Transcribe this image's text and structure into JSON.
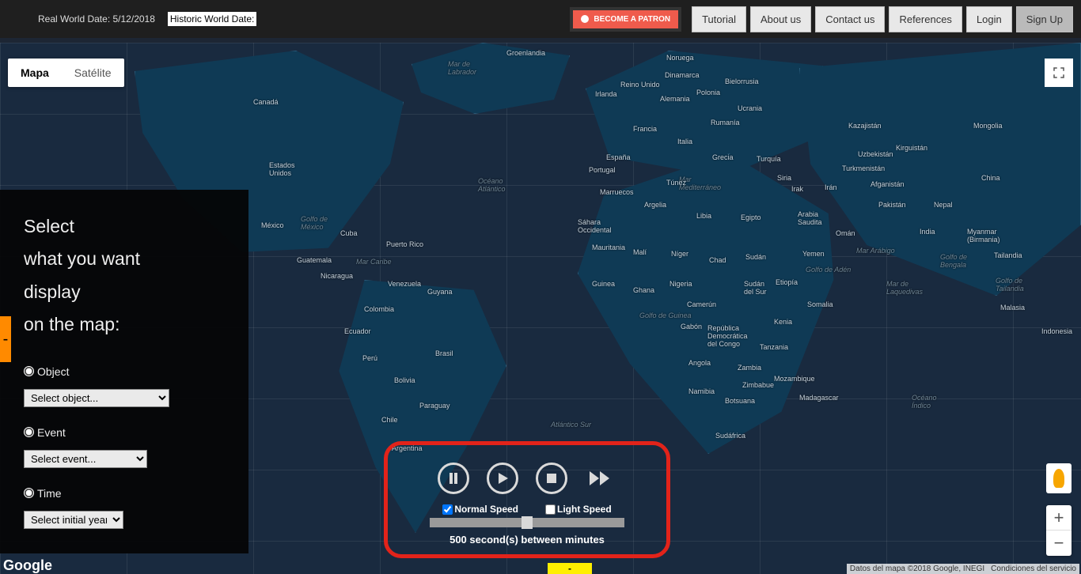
{
  "top": {
    "real_label": "Real World Date:",
    "real_date": "5/12/2018",
    "historic_label": "Historic World Date:",
    "patron": "BECOME A PATRON",
    "nav": [
      "Tutorial",
      "About us",
      "Contact us",
      "References",
      "Login",
      "Sign Up"
    ]
  },
  "maptype": {
    "map": "Mapa",
    "sat": "Satélite"
  },
  "sidebar": {
    "title_lines": [
      "Select",
      "what you want",
      "display",
      "on the map:"
    ],
    "object_label": "Object",
    "object_select": "Select object...",
    "event_label": "Event",
    "event_select": "Select event...",
    "time_label": "Time",
    "time_select": "Select initial year...",
    "collapse": "-"
  },
  "player": {
    "normal": "Normal Speed",
    "light": "Light Speed",
    "readout_value": "500",
    "readout_unit": "second(s) between minutes",
    "chip": "-"
  },
  "map_labels": {
    "canada": "Canadá",
    "us": "Estados\nUnidos",
    "mexico": "México",
    "golfo_mexico": "Golfo de\nMéxico",
    "cuba": "Cuba",
    "puerto_rico": "Puerto Rico",
    "mar_caribe": "Mar Caribe",
    "guatemala": "Guatemala",
    "nicaragua": "Nicaragua",
    "venezuela": "Venezuela",
    "guyana": "Guyana",
    "colombia": "Colombia",
    "ecuador": "Ecuador",
    "brasil": "Brasil",
    "peru": "Perú",
    "bolivia": "Bolivia",
    "paraguay": "Paraguay",
    "chile": "Chile",
    "argentina": "Argentina",
    "labrador": "Mar de\nLabrador",
    "groenlandia": "Groenlandia",
    "atl_norte": "Océano\nAtlántico",
    "atl_sur": "Atlántico Sur",
    "reino_unido": "Reino Unido",
    "irlanda": "Irlanda",
    "noruega": "Noruega",
    "dinamarca": "Dinamarca",
    "bielorrusia": "Bielorrusia",
    "polonia": "Polonia",
    "alemania": "Alemania",
    "francia": "Francia",
    "ucrania": "Ucrania",
    "rumania": "Rumanía",
    "espana": "España",
    "portugal": "Portugal",
    "italia": "Italia",
    "grecia": "Grecia",
    "turquia": "Turquía",
    "siria": "Siria",
    "irak": "Irak",
    "iran": "Irán",
    "kazajistan": "Kazajistán",
    "uzbekistan": "Uzbekistán",
    "turkmenistan": "Turkmenistán",
    "kirguistan": "Kirguistán",
    "afganistan": "Afganistán",
    "pakistan": "Pakistán",
    "india": "India",
    "nepal": "Nepal",
    "china": "China",
    "mongolia": "Mongolia",
    "myanmar": "Myanmar\n(Birmania)",
    "tailandia": "Tailandia",
    "golfo_tailandia": "Golfo de\nTailandia",
    "malasia": "Malasia",
    "indonesia": "Indonesia",
    "golfo_bengala": "Golfo de\nBengala",
    "mar_laquedivas": "Mar de\nLaquedivas",
    "mar_arabigo": "Mar Arábigo",
    "arabia": "Arabia\nSaudita",
    "oman": "Omán",
    "yemen": "Yemen",
    "golfo_aden": "Golfo de Adén",
    "mediterraneo": "Mar\nMediterráneo",
    "marruecos": "Marruecos",
    "tunez": "Túnez",
    "argelia": "Argelia",
    "libia": "Libia",
    "egipto": "Egipto",
    "sahara": "Sáhara\nOccidental",
    "mauritania": "Mauritania",
    "mali": "Malí",
    "niger": "Níger",
    "chad": "Chad",
    "sudan": "Sudán",
    "etiopia": "Etiopía",
    "somalia": "Somalia",
    "sudan_sur": "Sudán\ndel Sur",
    "nigeria": "Nigeria",
    "guinea": "Guinea",
    "ghana": "Ghana",
    "camerun": "Camerún",
    "golfo_guinea": "Golfo de Guinea",
    "gabon": "Gabón",
    "rdc": "República\nDemocrática\ndel Congo",
    "kenia": "Kenia",
    "tanzania": "Tanzania",
    "angola": "Angola",
    "zambia": "Zambia",
    "zimbabue": "Zimbabue",
    "mozambique": "Mozambique",
    "namibia": "Namibia",
    "botsuana": "Botsuana",
    "madagascar": "Madagascar",
    "sudafrica": "Sudáfrica",
    "indico": "Océano\nÍndico"
  },
  "zoom": {
    "in": "+",
    "out": "−"
  },
  "footer": {
    "logo": "Google",
    "credit1": "Datos del mapa ©2018 Google, INEGI",
    "credit2": "Condiciones del servicio"
  }
}
